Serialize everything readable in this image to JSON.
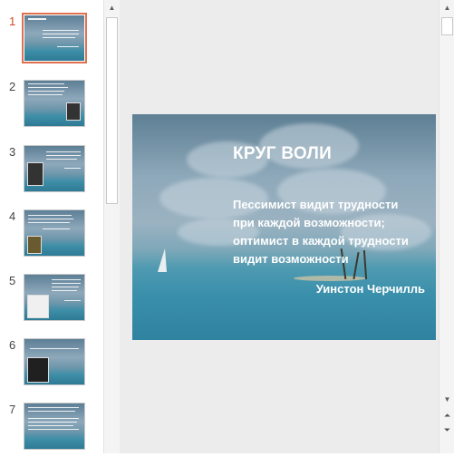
{
  "thumbnails": [
    {
      "number": "1"
    },
    {
      "number": "2"
    },
    {
      "number": "3"
    },
    {
      "number": "4"
    },
    {
      "number": "5"
    },
    {
      "number": "6"
    },
    {
      "number": "7"
    }
  ],
  "selected_slide": "1",
  "slide": {
    "title": "КРУГ ВОЛИ",
    "body_lines": [
      "Пессимист видит трудности",
      "при каждой возможности;",
      "оптимист в каждой трудности",
      "видит возможности"
    ],
    "author": "Уинстон Черчилль"
  },
  "colors": {
    "accent": "#d24726",
    "selection_border": "#e07050",
    "pane_bg": "#ececec"
  },
  "icons": {
    "scroll_up": "triangle-up-icon",
    "scroll_down": "triangle-down-icon",
    "prev_slide": "double-chevron-up-icon",
    "next_slide": "double-chevron-down-icon"
  }
}
